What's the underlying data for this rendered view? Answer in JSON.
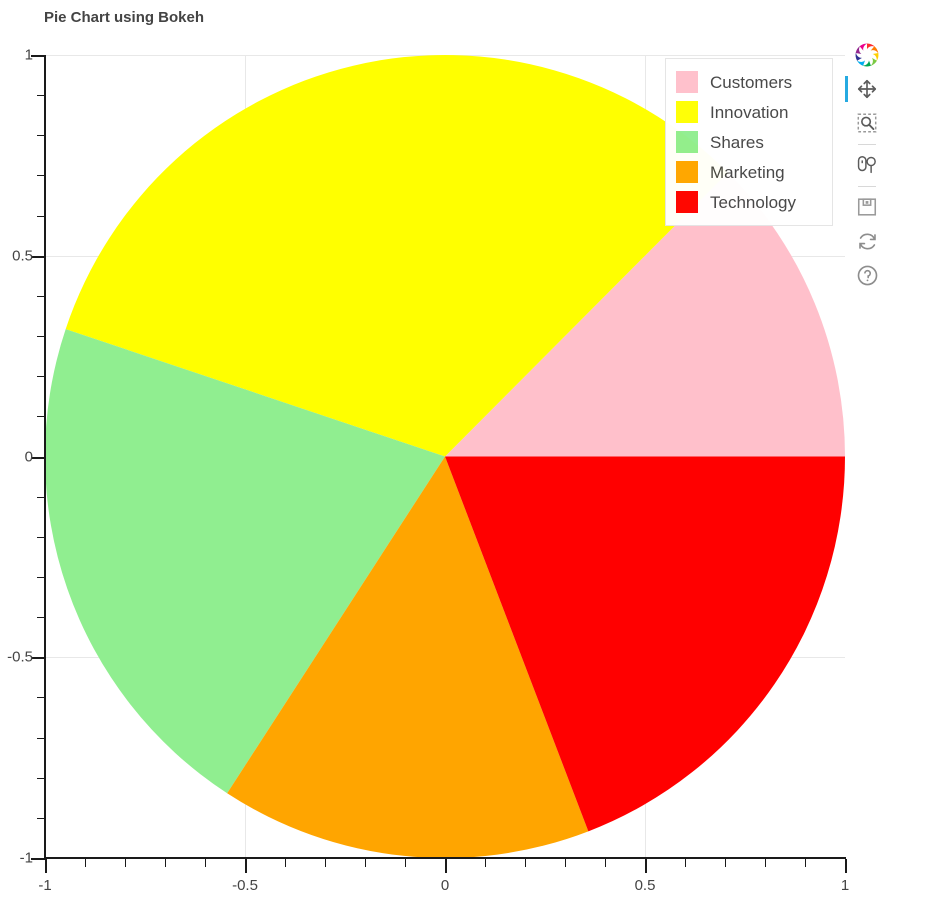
{
  "title": "Pie Chart using Bokeh",
  "legend": {
    "entries": [
      {
        "label": "Customers",
        "color": "#FFC0CB"
      },
      {
        "label": "Innovation",
        "color": "#FFFF00"
      },
      {
        "label": "Shares",
        "color": "#90EE90"
      },
      {
        "label": "Marketing",
        "color": "#FFA500"
      },
      {
        "label": "Technology",
        "color": "#FF0000"
      }
    ]
  },
  "axes": {
    "x": {
      "ticks": [
        "-1",
        "-0.5",
        "0",
        "0.5",
        "1"
      ],
      "values": [
        -1,
        -0.5,
        0,
        0.5,
        1
      ],
      "range": [
        -1,
        1
      ]
    },
    "y": {
      "ticks": [
        "1",
        "0.5",
        "0",
        "-0.5",
        "-1"
      ],
      "values": [
        1,
        0.5,
        0,
        -0.5,
        -1
      ],
      "range": [
        -1,
        1
      ]
    }
  },
  "toolbar": {
    "logo_label": "bokeh-logo",
    "tools": [
      {
        "name": "pan-tool",
        "label": "Pan",
        "active": true
      },
      {
        "name": "box-zoom-tool",
        "label": "Box Zoom",
        "active": false
      },
      {
        "name": "wheel-zoom-tool",
        "label": "Wheel Zoom",
        "active": false
      },
      {
        "name": "save-tool",
        "label": "Save",
        "active": false
      },
      {
        "name": "reset-tool",
        "label": "Reset",
        "active": false
      },
      {
        "name": "help-tool",
        "label": "Help",
        "active": false
      }
    ]
  },
  "colors": {
    "title": "#444444",
    "axis": "#1a1a1a",
    "grid": "#e8e8e8",
    "background": "#ffffff",
    "accent": "#26aae1"
  },
  "chart_data": {
    "type": "pie",
    "title": "Pie Chart using Bokeh",
    "xlabel": "",
    "ylabel": "",
    "xlim": [
      -1,
      1
    ],
    "ylim": [
      -1,
      1
    ],
    "grid": true,
    "legend_position": "top_right",
    "center": [
      0,
      0
    ],
    "radius": 1,
    "labels": [
      "Customers",
      "Innovation",
      "Shares",
      "Marketing",
      "Technology"
    ],
    "colors": [
      "#FFC0CB",
      "#FFFF00",
      "#90EE90",
      "#FFA500",
      "#FF0000"
    ],
    "percentages": [
      12.5,
      32.4,
      21.0,
      15.0,
      19.1
    ],
    "start_angles_deg": [
      0,
      45,
      161.5,
      237,
      291
    ],
    "end_angles_deg": [
      45,
      161.5,
      237,
      291,
      360
    ],
    "slices": [
      {
        "label": "Customers",
        "color": "#FFC0CB",
        "percent": 12.5,
        "start_angle_deg": 0,
        "end_angle_deg": 45
      },
      {
        "label": "Innovation",
        "color": "#FFFF00",
        "percent": 32.4,
        "start_angle_deg": 45,
        "end_angle_deg": 161.5
      },
      {
        "label": "Shares",
        "color": "#90EE90",
        "percent": 21.0,
        "start_angle_deg": 161.5,
        "end_angle_deg": 237
      },
      {
        "label": "Marketing",
        "color": "#FFA500",
        "percent": 15.0,
        "start_angle_deg": 237,
        "end_angle_deg": 291
      },
      {
        "label": "Technology",
        "color": "#FF0000",
        "percent": 19.1,
        "start_angle_deg": 291,
        "end_angle_deg": 360
      }
    ]
  }
}
